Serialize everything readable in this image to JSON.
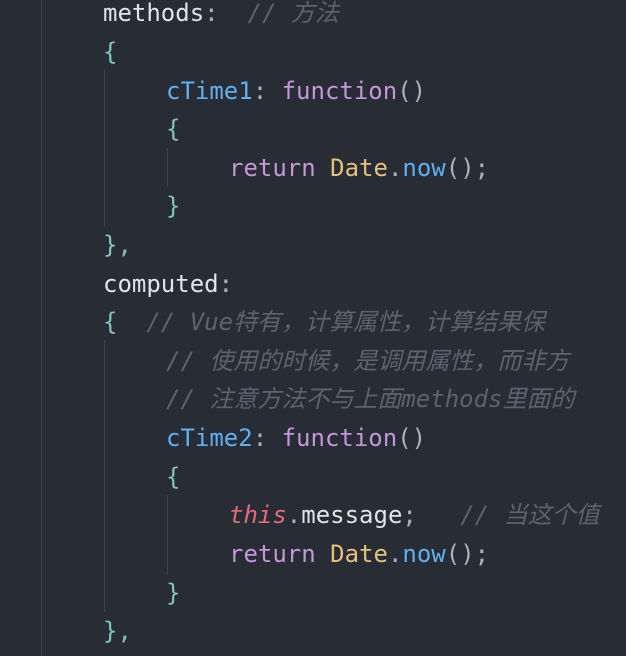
{
  "editor": {
    "lines": [
      {
        "prop": "methods",
        "colon": ":",
        "comment": "// 方法"
      },
      {
        "brace": "{"
      },
      {
        "name": "cTime1",
        "colon": ":",
        "kw": "function",
        "parens": "()"
      },
      {
        "brace": "{"
      },
      {
        "kw": "return",
        "cls": "Date",
        "dot": ".",
        "method": "now",
        "tail": "();"
      },
      {
        "brace": "}"
      },
      {
        "brace": "},"
      },
      {
        "prop": "computed",
        "colon": ":"
      },
      {
        "brace": "{",
        "comment": "// Vue特有，计算属性，计算结果保"
      },
      {
        "comment": "// 使用的时候，是调用属性，而非方"
      },
      {
        "comment": "// 注意方法不与上面methods里面的"
      },
      {
        "name": "cTime2",
        "colon": ":",
        "kw": "function",
        "parens": "()"
      },
      {
        "brace": "{"
      },
      {
        "this": "this",
        "dot": ".",
        "member": "message",
        "semi": ";",
        "comment": "// 当这个值"
      },
      {
        "kw": "return",
        "cls": "Date",
        "dot": ".",
        "method": "now",
        "tail": "();"
      },
      {
        "brace": "}"
      },
      {
        "brace": "},"
      }
    ]
  },
  "colors": {
    "background": "#282c34",
    "keyword": "#c397d8",
    "function_name": "#61afef",
    "class_name": "#e5c07b",
    "this_keyword": "#e06c75",
    "comment": "#5c6370"
  }
}
